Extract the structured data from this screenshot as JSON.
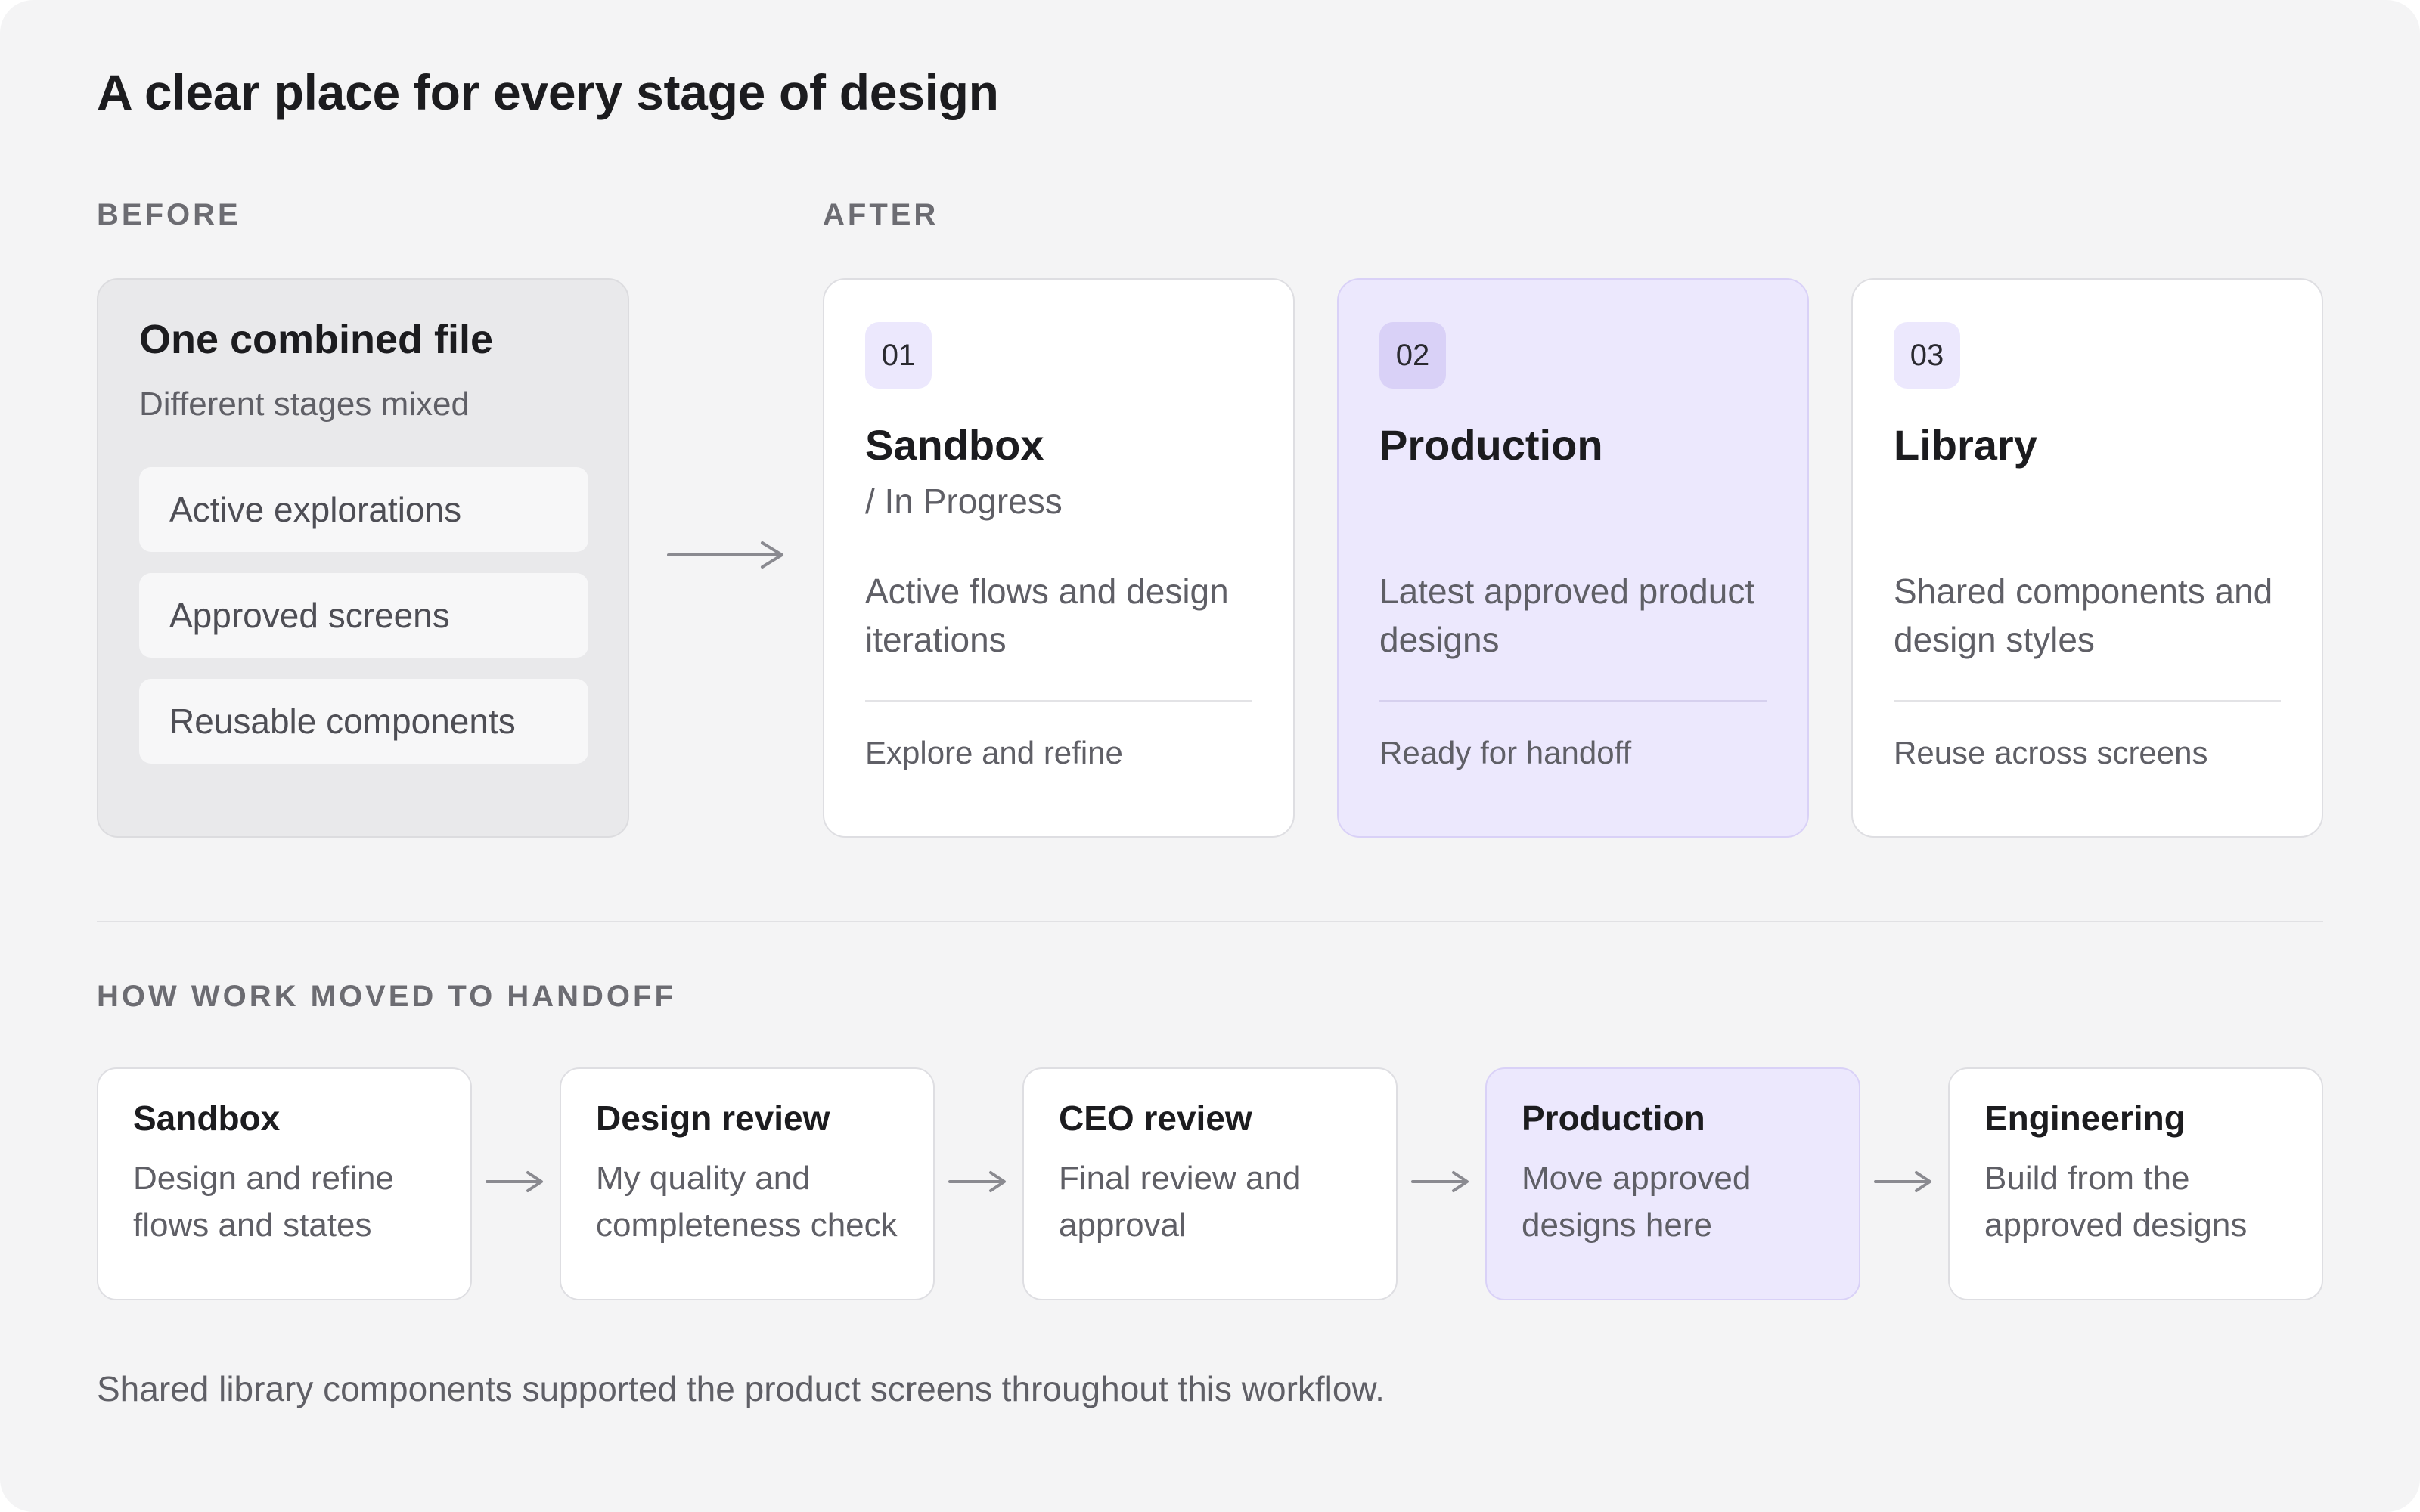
{
  "title": "A clear place for every stage of design",
  "before": {
    "label": "BEFORE",
    "card_title": "One combined file",
    "card_subtitle": "Different stages mixed",
    "items": [
      "Active explorations",
      "Approved screens",
      "Reusable components"
    ]
  },
  "after": {
    "label": "AFTER",
    "stages": [
      {
        "number": "01",
        "name": "Sandbox",
        "subtitle": "/ In Progress",
        "description": "Active flows and design iterations",
        "note": "Explore and refine",
        "highlighted": false
      },
      {
        "number": "02",
        "name": "Production",
        "subtitle": "",
        "description": "Latest approved product designs",
        "note": "Ready for handoff",
        "highlighted": true
      },
      {
        "number": "03",
        "name": "Library",
        "subtitle": "",
        "description": "Shared components and design styles",
        "note": "Reuse across screens",
        "highlighted": false
      }
    ]
  },
  "handoff": {
    "label": "HOW WORK MOVED TO HANDOFF",
    "steps": [
      {
        "title": "Sandbox",
        "description": "Design and refine flows and states",
        "highlighted": false
      },
      {
        "title": "Design review",
        "description": "My quality and completeness check",
        "highlighted": false
      },
      {
        "title": "CEO review",
        "description": "Final review and approval",
        "highlighted": false
      },
      {
        "title": "Production",
        "description": "Move approved designs here",
        "highlighted": true
      },
      {
        "title": "Engineering",
        "description": "Build from the approved designs",
        "highlighted": false
      }
    ]
  },
  "footer": "Shared library components supported the product screens throughout this workflow.",
  "colors": {
    "background": "#f4f4f5",
    "highlight": "#ece8fd",
    "highlight_border": "#d9d1f7",
    "badge": "#ece8fd",
    "text_primary": "#1c1c1f",
    "text_secondary": "#5f5f66",
    "arrow": "#8a8a90"
  },
  "icons": {
    "flow_arrow": "right-arrow-icon"
  }
}
